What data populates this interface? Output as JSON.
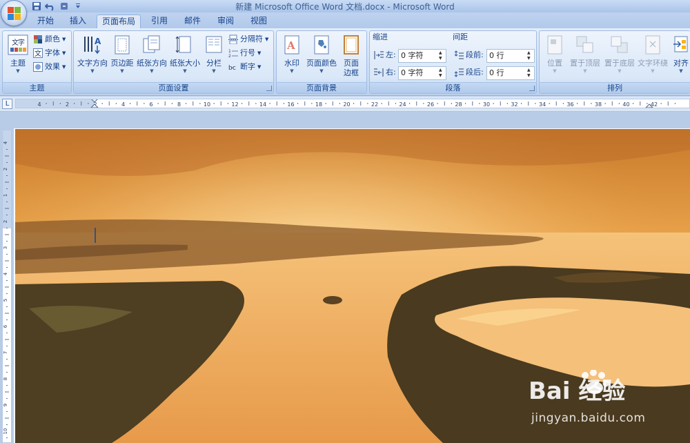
{
  "window": {
    "title": "新建 Microsoft Office Word 文档.docx - Microsoft Word"
  },
  "quick_access": [
    "save-icon",
    "undo-icon",
    "redo-icon",
    "customize-icon"
  ],
  "tabs": [
    "开始",
    "插入",
    "页面布局",
    "引用",
    "邮件",
    "审阅",
    "视图"
  ],
  "active_tab": "页面布局",
  "ribbon": {
    "theme_group": {
      "label": "主题",
      "theme_button": "主题",
      "colors": "颜色",
      "fonts": "字体",
      "effects": "效果"
    },
    "page_setup_group": {
      "label": "页面设置",
      "text_direction": "文字方向",
      "margins": "页边距",
      "orientation": "纸张方向",
      "size": "纸张大小",
      "columns": "分栏",
      "breaks": "分隔符",
      "line_numbers": "行号",
      "hyphenation": "断字"
    },
    "page_background_group": {
      "label": "页面背景",
      "watermark": "水印",
      "page_color": "页面颜色",
      "page_borders_line1": "页面",
      "page_borders_line2": "边框"
    },
    "paragraph_group": {
      "label": "段落",
      "indent_title": "缩进",
      "indent_left_label": "左:",
      "indent_left_value": "0 字符",
      "indent_right_label": "右:",
      "indent_right_value": "0 字符",
      "spacing_title": "间距",
      "spacing_before_label": "段前:",
      "spacing_before_value": "0 行",
      "spacing_after_label": "段后:",
      "spacing_after_value": "0 行"
    },
    "arrange_group": {
      "label": "排列",
      "position": "位置",
      "bring_front": "置于顶层",
      "send_back": "置于底层",
      "text_wrap": "文字环绕",
      "align": "对齐"
    }
  },
  "ruler": {
    "h_numbers": [
      "4",
      "2",
      "2",
      "4",
      "6",
      "8",
      "10",
      "12",
      "14",
      "16",
      "18",
      "20",
      "22",
      "24",
      "26",
      "28",
      "30",
      "32",
      "34",
      "36",
      "38",
      "40",
      "42"
    ],
    "v_numbers": [
      "4",
      "2",
      "1",
      "2",
      "3",
      "4",
      "5",
      "6",
      "7",
      "8",
      "9",
      "10"
    ]
  },
  "watermark": {
    "brand": "Bai 经验",
    "site": "jingyan.baidu.com"
  },
  "colors": {
    "ribbon_text": "#15428b",
    "accent": "#8db2e3"
  }
}
